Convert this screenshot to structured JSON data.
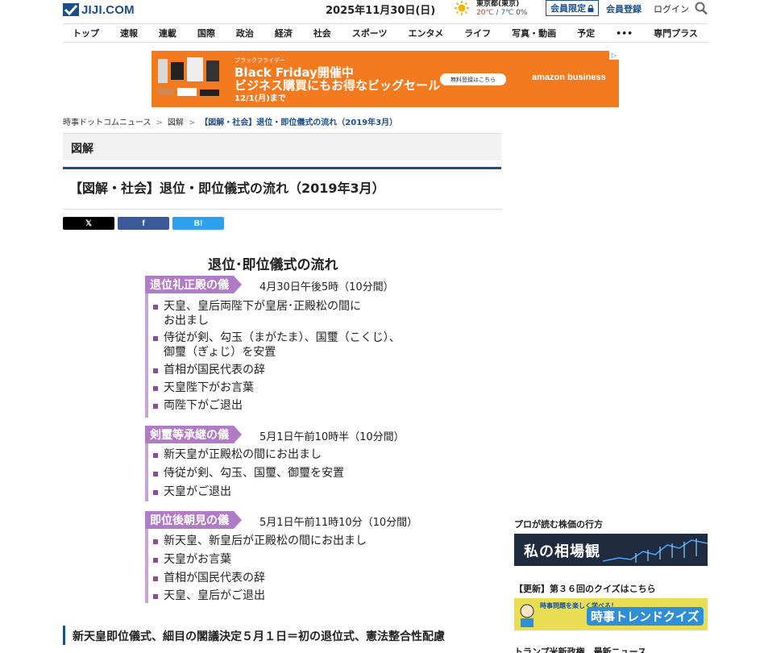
{
  "header": {
    "logo_text": "JIJI.COM",
    "date": "2025年11月30日(日)",
    "weather": {
      "city": "東京都(東京)",
      "high": "20℃",
      "sep": "/",
      "low": "7℃",
      "rain": "0%"
    },
    "member_only": "会員限定",
    "register": "会員登録",
    "login": "ログイン"
  },
  "nav": [
    "トップ",
    "速報",
    "連載",
    "国際",
    "政治",
    "経済",
    "社会",
    "スポーツ",
    "エンタメ",
    "ライフ",
    "写真・動画",
    "予定",
    "•••",
    "専門プラス"
  ],
  "ad": {
    "small": "ブラックフライデー",
    "line1": "Black Friday開催中",
    "line2": "ビジネス購買にもお得なビッグセール",
    "line3": "12/1(月)まで",
    "button": "無料登録はこちら",
    "brand": "amazon business",
    "choice": "▷"
  },
  "breadcrumb": {
    "home": "時事ドットコムニュース",
    "sep": ">",
    "section": "図解",
    "current": "【図解・社会】退位・即位儀式の流れ（2019年3月）"
  },
  "category": "図解",
  "article_title": "【図解・社会】退位・即位儀式の流れ（2019年3月）",
  "share": {
    "x": "𝕏",
    "facebook": "f",
    "hatena": "B!"
  },
  "figure": {
    "title": "退位･即位儀式の流れ",
    "sections": [
      {
        "label": "退位礼正殿の儀",
        "time": "4月30日午後5時（10分間）",
        "items": [
          [
            "天皇、皇后両陛下が皇居･正殿松の間に",
            "お出まし"
          ],
          [
            "侍従が剣、勾玉（まがたま）、国璽（こくじ）、",
            "御璽（ぎょじ）を安置"
          ],
          [
            "首相が国民代表の辞"
          ],
          [
            "天皇陛下がお言葉"
          ],
          [
            "両陛下がご退出"
          ]
        ]
      },
      {
        "label": "剣璽等承継の儀",
        "time": "5月1日午前10時半（10分間）",
        "items": [
          [
            "新天皇が正殿松の間にお出まし"
          ],
          [
            "侍従が剣、勾玉、国璽、御璽を安置"
          ],
          [
            "天皇がご退出"
          ]
        ]
      },
      {
        "label": "即位後朝見の儀",
        "time": "5月1日午前11時10分（10分間）",
        "items": [
          [
            "新天皇、新皇后が正殿松の間にお出まし"
          ],
          [
            "天皇がお言葉"
          ],
          [
            "首相が国民代表の辞"
          ],
          [
            "天皇、皇后がご退出"
          ]
        ]
      }
    ]
  },
  "related_title": "新天皇即位儀式、細目の閣議決定５月１日＝初の退位式、憲法整合性配慮",
  "sidebar": {
    "heading1": "プロが読む株価の行方",
    "banner1": "私の相場観",
    "heading2": "【更新】第３６回のクイズはこちら",
    "banner2_small": "時事問題を楽しく学べる！",
    "banner2_big": "時事トレンドクイズ",
    "heading3": "トランプ米新政権　最新ニュース"
  },
  "colors": {
    "brand": "#1c4f8a",
    "ad": "#f47a20",
    "figure_accent": "#b07cc6"
  }
}
